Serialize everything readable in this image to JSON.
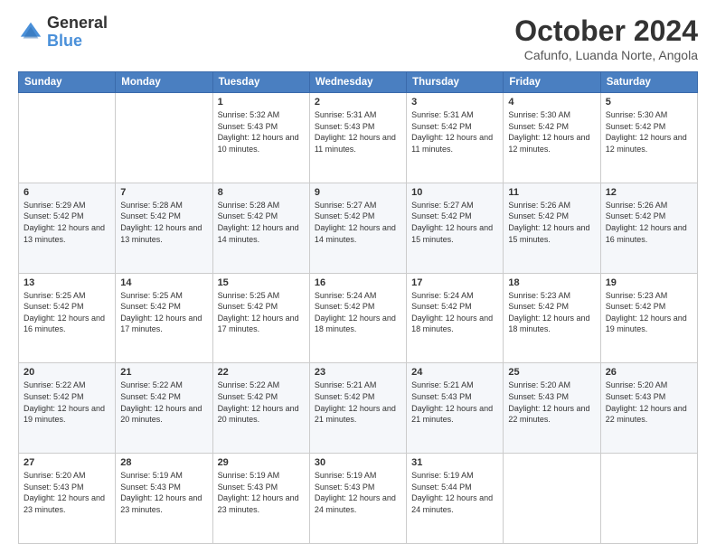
{
  "header": {
    "logo_general": "General",
    "logo_blue": "Blue",
    "month_title": "October 2024",
    "location": "Cafunfo, Luanda Norte, Angola"
  },
  "weekdays": [
    "Sunday",
    "Monday",
    "Tuesday",
    "Wednesday",
    "Thursday",
    "Friday",
    "Saturday"
  ],
  "weeks": [
    [
      {
        "day": "",
        "sunrise": "",
        "sunset": "",
        "daylight": ""
      },
      {
        "day": "",
        "sunrise": "",
        "sunset": "",
        "daylight": ""
      },
      {
        "day": "1",
        "sunrise": "Sunrise: 5:32 AM",
        "sunset": "Sunset: 5:43 PM",
        "daylight": "Daylight: 12 hours and 10 minutes."
      },
      {
        "day": "2",
        "sunrise": "Sunrise: 5:31 AM",
        "sunset": "Sunset: 5:43 PM",
        "daylight": "Daylight: 12 hours and 11 minutes."
      },
      {
        "day": "3",
        "sunrise": "Sunrise: 5:31 AM",
        "sunset": "Sunset: 5:42 PM",
        "daylight": "Daylight: 12 hours and 11 minutes."
      },
      {
        "day": "4",
        "sunrise": "Sunrise: 5:30 AM",
        "sunset": "Sunset: 5:42 PM",
        "daylight": "Daylight: 12 hours and 12 minutes."
      },
      {
        "day": "5",
        "sunrise": "Sunrise: 5:30 AM",
        "sunset": "Sunset: 5:42 PM",
        "daylight": "Daylight: 12 hours and 12 minutes."
      }
    ],
    [
      {
        "day": "6",
        "sunrise": "Sunrise: 5:29 AM",
        "sunset": "Sunset: 5:42 PM",
        "daylight": "Daylight: 12 hours and 13 minutes."
      },
      {
        "day": "7",
        "sunrise": "Sunrise: 5:28 AM",
        "sunset": "Sunset: 5:42 PM",
        "daylight": "Daylight: 12 hours and 13 minutes."
      },
      {
        "day": "8",
        "sunrise": "Sunrise: 5:28 AM",
        "sunset": "Sunset: 5:42 PM",
        "daylight": "Daylight: 12 hours and 14 minutes."
      },
      {
        "day": "9",
        "sunrise": "Sunrise: 5:27 AM",
        "sunset": "Sunset: 5:42 PM",
        "daylight": "Daylight: 12 hours and 14 minutes."
      },
      {
        "day": "10",
        "sunrise": "Sunrise: 5:27 AM",
        "sunset": "Sunset: 5:42 PM",
        "daylight": "Daylight: 12 hours and 15 minutes."
      },
      {
        "day": "11",
        "sunrise": "Sunrise: 5:26 AM",
        "sunset": "Sunset: 5:42 PM",
        "daylight": "Daylight: 12 hours and 15 minutes."
      },
      {
        "day": "12",
        "sunrise": "Sunrise: 5:26 AM",
        "sunset": "Sunset: 5:42 PM",
        "daylight": "Daylight: 12 hours and 16 minutes."
      }
    ],
    [
      {
        "day": "13",
        "sunrise": "Sunrise: 5:25 AM",
        "sunset": "Sunset: 5:42 PM",
        "daylight": "Daylight: 12 hours and 16 minutes."
      },
      {
        "day": "14",
        "sunrise": "Sunrise: 5:25 AM",
        "sunset": "Sunset: 5:42 PM",
        "daylight": "Daylight: 12 hours and 17 minutes."
      },
      {
        "day": "15",
        "sunrise": "Sunrise: 5:25 AM",
        "sunset": "Sunset: 5:42 PM",
        "daylight": "Daylight: 12 hours and 17 minutes."
      },
      {
        "day": "16",
        "sunrise": "Sunrise: 5:24 AM",
        "sunset": "Sunset: 5:42 PM",
        "daylight": "Daylight: 12 hours and 18 minutes."
      },
      {
        "day": "17",
        "sunrise": "Sunrise: 5:24 AM",
        "sunset": "Sunset: 5:42 PM",
        "daylight": "Daylight: 12 hours and 18 minutes."
      },
      {
        "day": "18",
        "sunrise": "Sunrise: 5:23 AM",
        "sunset": "Sunset: 5:42 PM",
        "daylight": "Daylight: 12 hours and 18 minutes."
      },
      {
        "day": "19",
        "sunrise": "Sunrise: 5:23 AM",
        "sunset": "Sunset: 5:42 PM",
        "daylight": "Daylight: 12 hours and 19 minutes."
      }
    ],
    [
      {
        "day": "20",
        "sunrise": "Sunrise: 5:22 AM",
        "sunset": "Sunset: 5:42 PM",
        "daylight": "Daylight: 12 hours and 19 minutes."
      },
      {
        "day": "21",
        "sunrise": "Sunrise: 5:22 AM",
        "sunset": "Sunset: 5:42 PM",
        "daylight": "Daylight: 12 hours and 20 minutes."
      },
      {
        "day": "22",
        "sunrise": "Sunrise: 5:22 AM",
        "sunset": "Sunset: 5:42 PM",
        "daylight": "Daylight: 12 hours and 20 minutes."
      },
      {
        "day": "23",
        "sunrise": "Sunrise: 5:21 AM",
        "sunset": "Sunset: 5:42 PM",
        "daylight": "Daylight: 12 hours and 21 minutes."
      },
      {
        "day": "24",
        "sunrise": "Sunrise: 5:21 AM",
        "sunset": "Sunset: 5:43 PM",
        "daylight": "Daylight: 12 hours and 21 minutes."
      },
      {
        "day": "25",
        "sunrise": "Sunrise: 5:20 AM",
        "sunset": "Sunset: 5:43 PM",
        "daylight": "Daylight: 12 hours and 22 minutes."
      },
      {
        "day": "26",
        "sunrise": "Sunrise: 5:20 AM",
        "sunset": "Sunset: 5:43 PM",
        "daylight": "Daylight: 12 hours and 22 minutes."
      }
    ],
    [
      {
        "day": "27",
        "sunrise": "Sunrise: 5:20 AM",
        "sunset": "Sunset: 5:43 PM",
        "daylight": "Daylight: 12 hours and 23 minutes."
      },
      {
        "day": "28",
        "sunrise": "Sunrise: 5:19 AM",
        "sunset": "Sunset: 5:43 PM",
        "daylight": "Daylight: 12 hours and 23 minutes."
      },
      {
        "day": "29",
        "sunrise": "Sunrise: 5:19 AM",
        "sunset": "Sunset: 5:43 PM",
        "daylight": "Daylight: 12 hours and 23 minutes."
      },
      {
        "day": "30",
        "sunrise": "Sunrise: 5:19 AM",
        "sunset": "Sunset: 5:43 PM",
        "daylight": "Daylight: 12 hours and 24 minutes."
      },
      {
        "day": "31",
        "sunrise": "Sunrise: 5:19 AM",
        "sunset": "Sunset: 5:44 PM",
        "daylight": "Daylight: 12 hours and 24 minutes."
      },
      {
        "day": "",
        "sunrise": "",
        "sunset": "",
        "daylight": ""
      },
      {
        "day": "",
        "sunrise": "",
        "sunset": "",
        "daylight": ""
      }
    ]
  ]
}
